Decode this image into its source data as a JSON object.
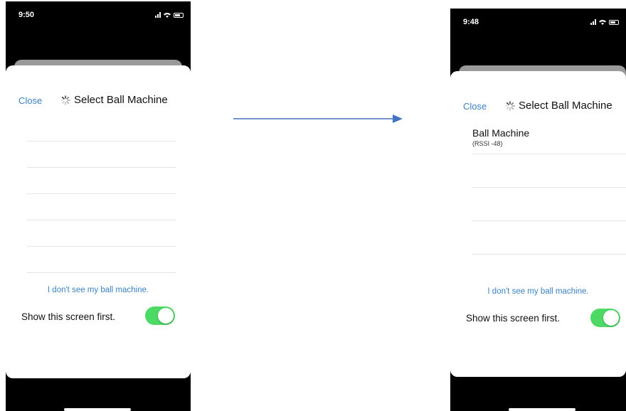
{
  "left_screen": {
    "status_time": "9:50",
    "close_label": "Close",
    "title": "Select Ball Machine",
    "help_link": "I don't see my ball machine.",
    "show_first_label": "Show this screen first.",
    "toggle_on": true
  },
  "right_screen": {
    "status_time": "9:48",
    "close_label": "Close",
    "title": "Select Ball Machine",
    "device": {
      "name": "Ball Machine",
      "rssi": "(RSSI -48)"
    },
    "help_link": "I don't see my ball machine.",
    "show_first_label": "Show this screen first.",
    "toggle_on": true
  },
  "colors": {
    "link": "#3b82c4",
    "toggle_on": "#4cd964",
    "arrow": "#4472c4"
  },
  "icons": [
    "signal-icon",
    "wifi-icon",
    "battery-icon",
    "spinner-icon",
    "arrow-right-icon"
  ]
}
